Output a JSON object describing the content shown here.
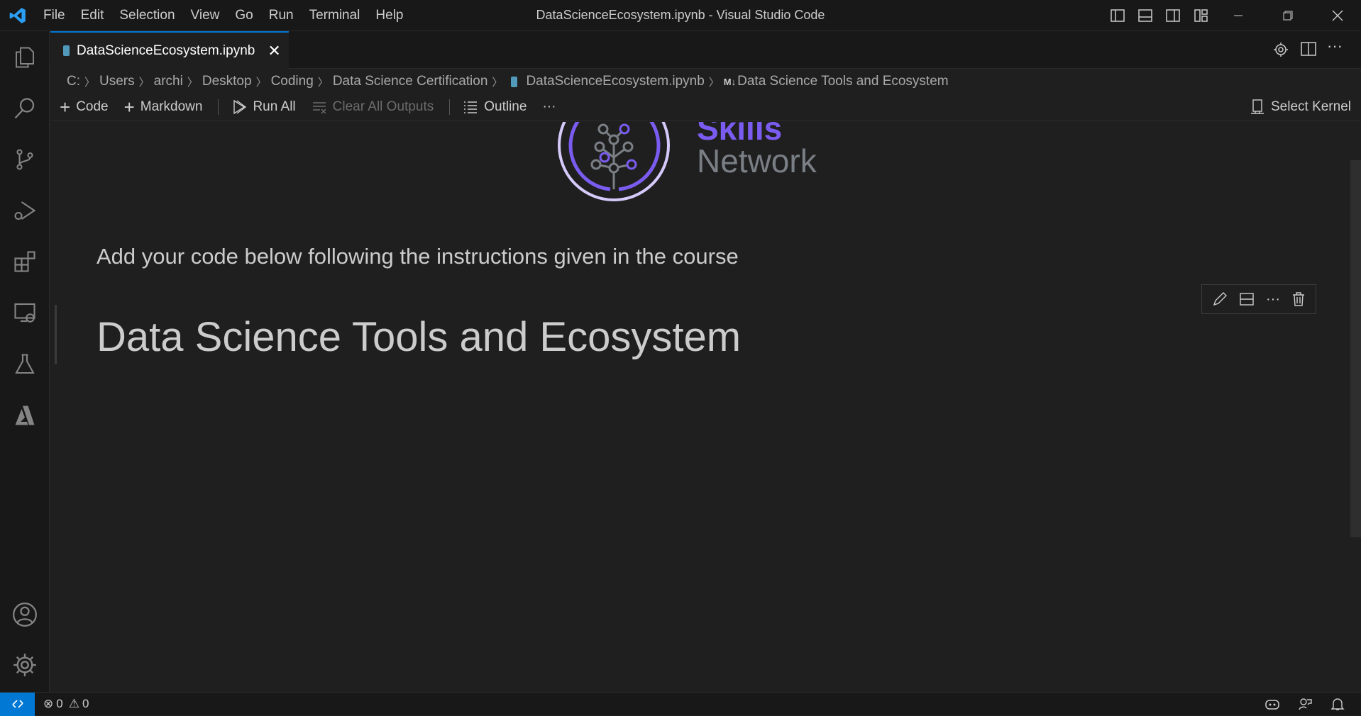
{
  "titlebar": {
    "menu": [
      "File",
      "Edit",
      "Selection",
      "View",
      "Go",
      "Run",
      "Terminal",
      "Help"
    ],
    "title": "DataScienceEcosystem.ipynb - Visual Studio Code"
  },
  "tab": {
    "label": "DataScienceEcosystem.ipynb"
  },
  "breadcrumb": [
    "C:",
    "Users",
    "archi",
    "Desktop",
    "Coding",
    "Data Science Certification",
    "DataScienceEcosystem.ipynb",
    "Data Science Tools and Ecosystem"
  ],
  "breadcrumb_md_badge": "M↓",
  "toolbar": {
    "code": "Code",
    "markdown": "Markdown",
    "run_all": "Run All",
    "clear_outputs": "Clear All Outputs",
    "outline": "Outline",
    "more": "···",
    "kernel": "Select Kernel"
  },
  "notebook": {
    "logo_top": "Skills",
    "logo_bottom": "Network",
    "instruction": "Add your code below following the instructions given in the course",
    "heading": "Data Science Tools and Ecosystem"
  },
  "status": {
    "errors": "0",
    "warnings": "0"
  },
  "colors": {
    "accent": "#0078d4",
    "logo_purple": "#7b5cf0",
    "logo_gray": "#7a7f85"
  }
}
